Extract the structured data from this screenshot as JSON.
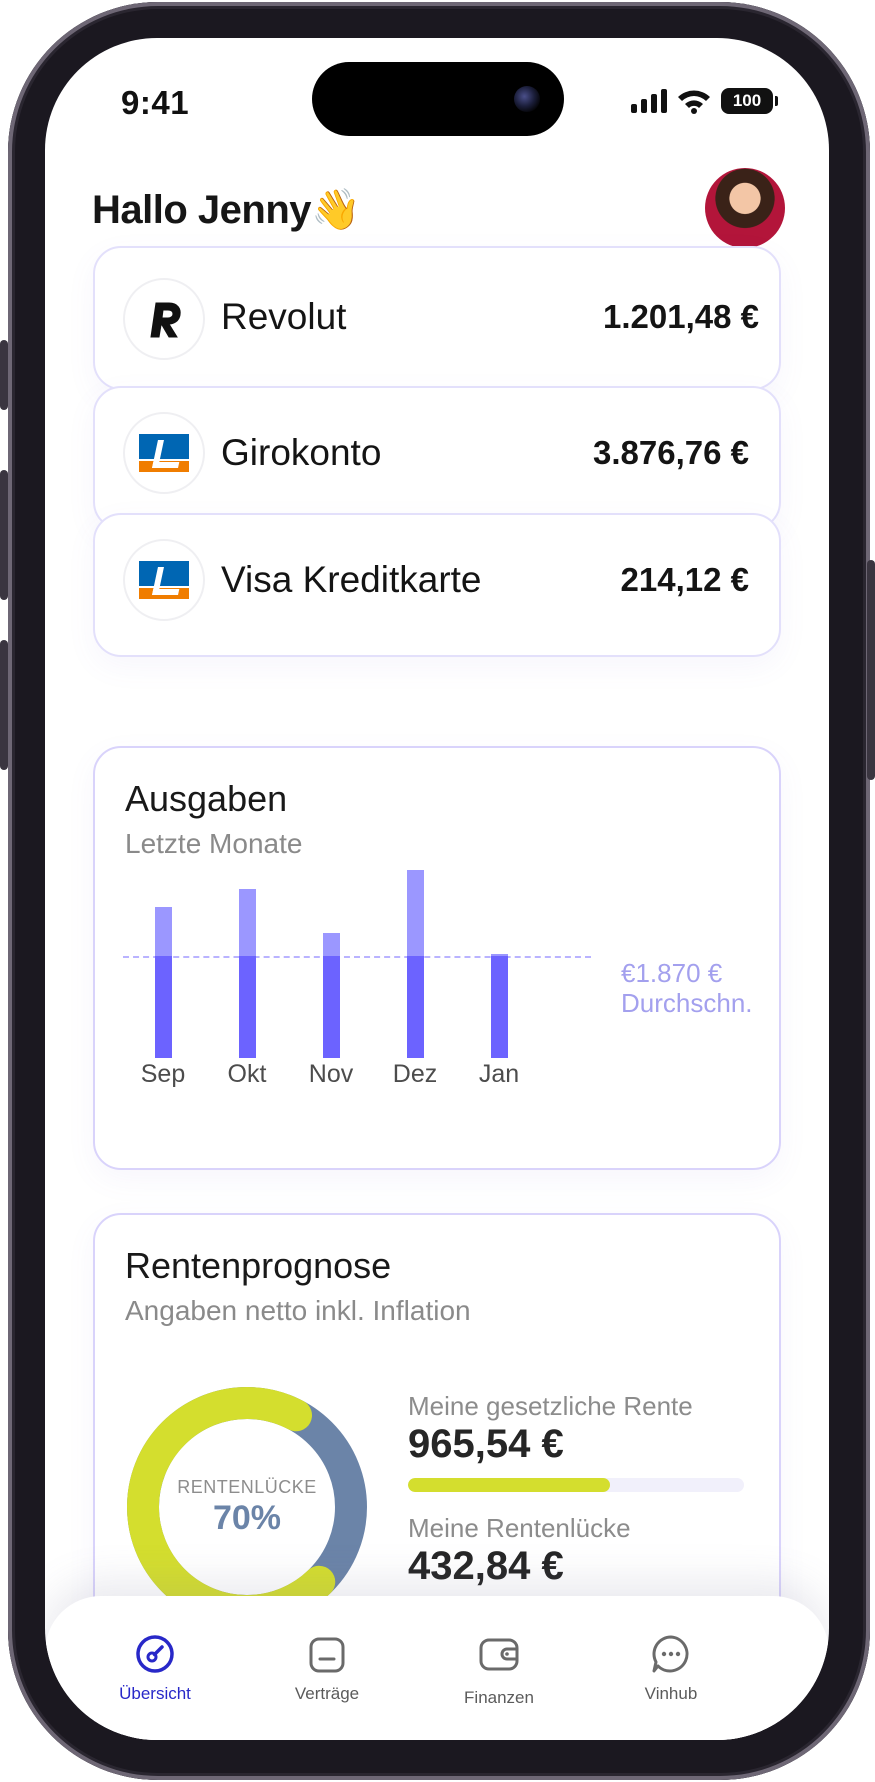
{
  "status_bar": {
    "time": "9:41",
    "battery": "100"
  },
  "header": {
    "greeting": "Hallo Jenny",
    "greeting_emoji": "👋"
  },
  "accounts": [
    {
      "name": "Revolut",
      "amount": "1.201,48 €",
      "logo": "revolut-logo"
    },
    {
      "name": "Girokonto",
      "amount": "3.876,76 €",
      "logo": "volksbank-logo"
    },
    {
      "name": "Visa Kreditkarte",
      "amount": "214,12 €",
      "logo": "volksbank-logo"
    }
  ],
  "expenses": {
    "title": "Ausgaben",
    "subtitle": "Letzte Monate",
    "average_value": "€1.870 €",
    "average_label": "Durchschn.",
    "colors": {
      "above_average": "#9b97ff",
      "below_average": "#6c63ff"
    }
  },
  "chart_data": {
    "type": "bar",
    "categories": [
      "Sep",
      "Okt",
      "Nov",
      "Dez",
      "Jan"
    ],
    "values": [
      2780,
      3120,
      2300,
      3460,
      1920
    ],
    "average": 1870,
    "ylim": [
      0,
      3500
    ]
  },
  "pension": {
    "title": "Rentenprognose",
    "subtitle": "Angaben netto inkl. Inflation",
    "gap_label": "RENTENLÜCKE",
    "gap_percent": "70%",
    "gap_fraction": 0.7,
    "statutory_label": "Meine gesetzliche Rente",
    "statutory_value": "965,54 €",
    "statutory_progress": 0.6,
    "gap_amount_label": "Meine Rentenlücke",
    "gap_amount_value": "432,84 €",
    "colors": {
      "lime": "#d4de2e",
      "slate": "#6b84a8"
    }
  },
  "tabbar": {
    "items": [
      {
        "label": "Übersicht",
        "icon": "gauge-icon",
        "active": true
      },
      {
        "label": "Verträge",
        "icon": "folder-icon",
        "active": false
      },
      {
        "label": "Finanzen",
        "icon": "wallet-icon",
        "active": false
      },
      {
        "label": "Vinhub",
        "icon": "chat-icon",
        "active": false
      }
    ],
    "active_color": "#2828c8"
  }
}
